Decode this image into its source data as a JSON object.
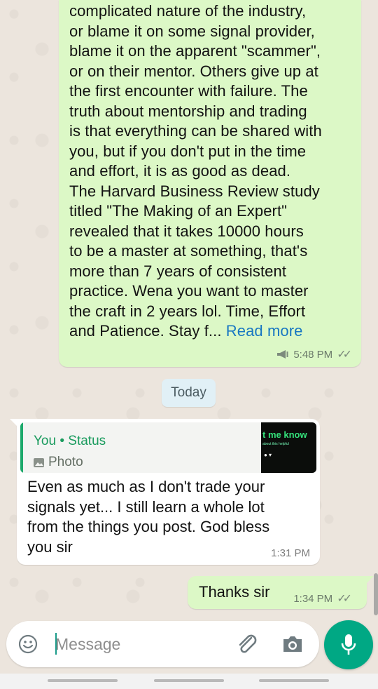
{
  "colors": {
    "outgoing_bubble": "#dcf8c6",
    "incoming_bubble": "#ffffff",
    "accent_green": "#00a884",
    "link_blue": "#1877c2",
    "wallpaper": "#ece5dd"
  },
  "messages": {
    "long": {
      "text": "complicated nature of the industry,\nor blame it on some signal provider,\nblame it on the apparent \"scammer\",\nor on their mentor. Others give up at\nthe first encounter with failure. The\ntruth about mentorship and trading\nis that everything can be shared with\nyou,  but if you don't put in the time\nand effort,  it is as good as dead.\nThe Harvard Business Review study\ntitled \"The Making of an Expert\"\nrevealed that it takes 10000 hours\nto be a master at something, that's\nmore than 7 years of consistent\npractice.  Wena you want to master\nthe craft in 2 years lol. Time,  Effort\nand Patience. Stay f... ",
      "read_more": "Read more",
      "time": "5:48 PM",
      "icon": "megaphone-icon"
    },
    "date_divider": "Today",
    "reply": {
      "quote_author": "You",
      "quote_sep": "•",
      "quote_source": "Status",
      "quote_type": "Photo",
      "thumb_title": "t me know",
      "thumb_subtitle": "about this helpful",
      "text": "Even as much as I don't trade your\nsignals yet... I still learn a whole lot\nfrom the things you post. God bless\nyou sir",
      "time": "1:31 PM"
    },
    "short": {
      "text": "Thanks sir",
      "time": "1:34 PM",
      "status": "read-ticks"
    }
  },
  "composer": {
    "placeholder": "Message",
    "emoji_icon": "emoji-icon",
    "attach_icon": "paperclip-icon",
    "camera_icon": "camera-icon",
    "mic_icon": "mic-icon"
  }
}
